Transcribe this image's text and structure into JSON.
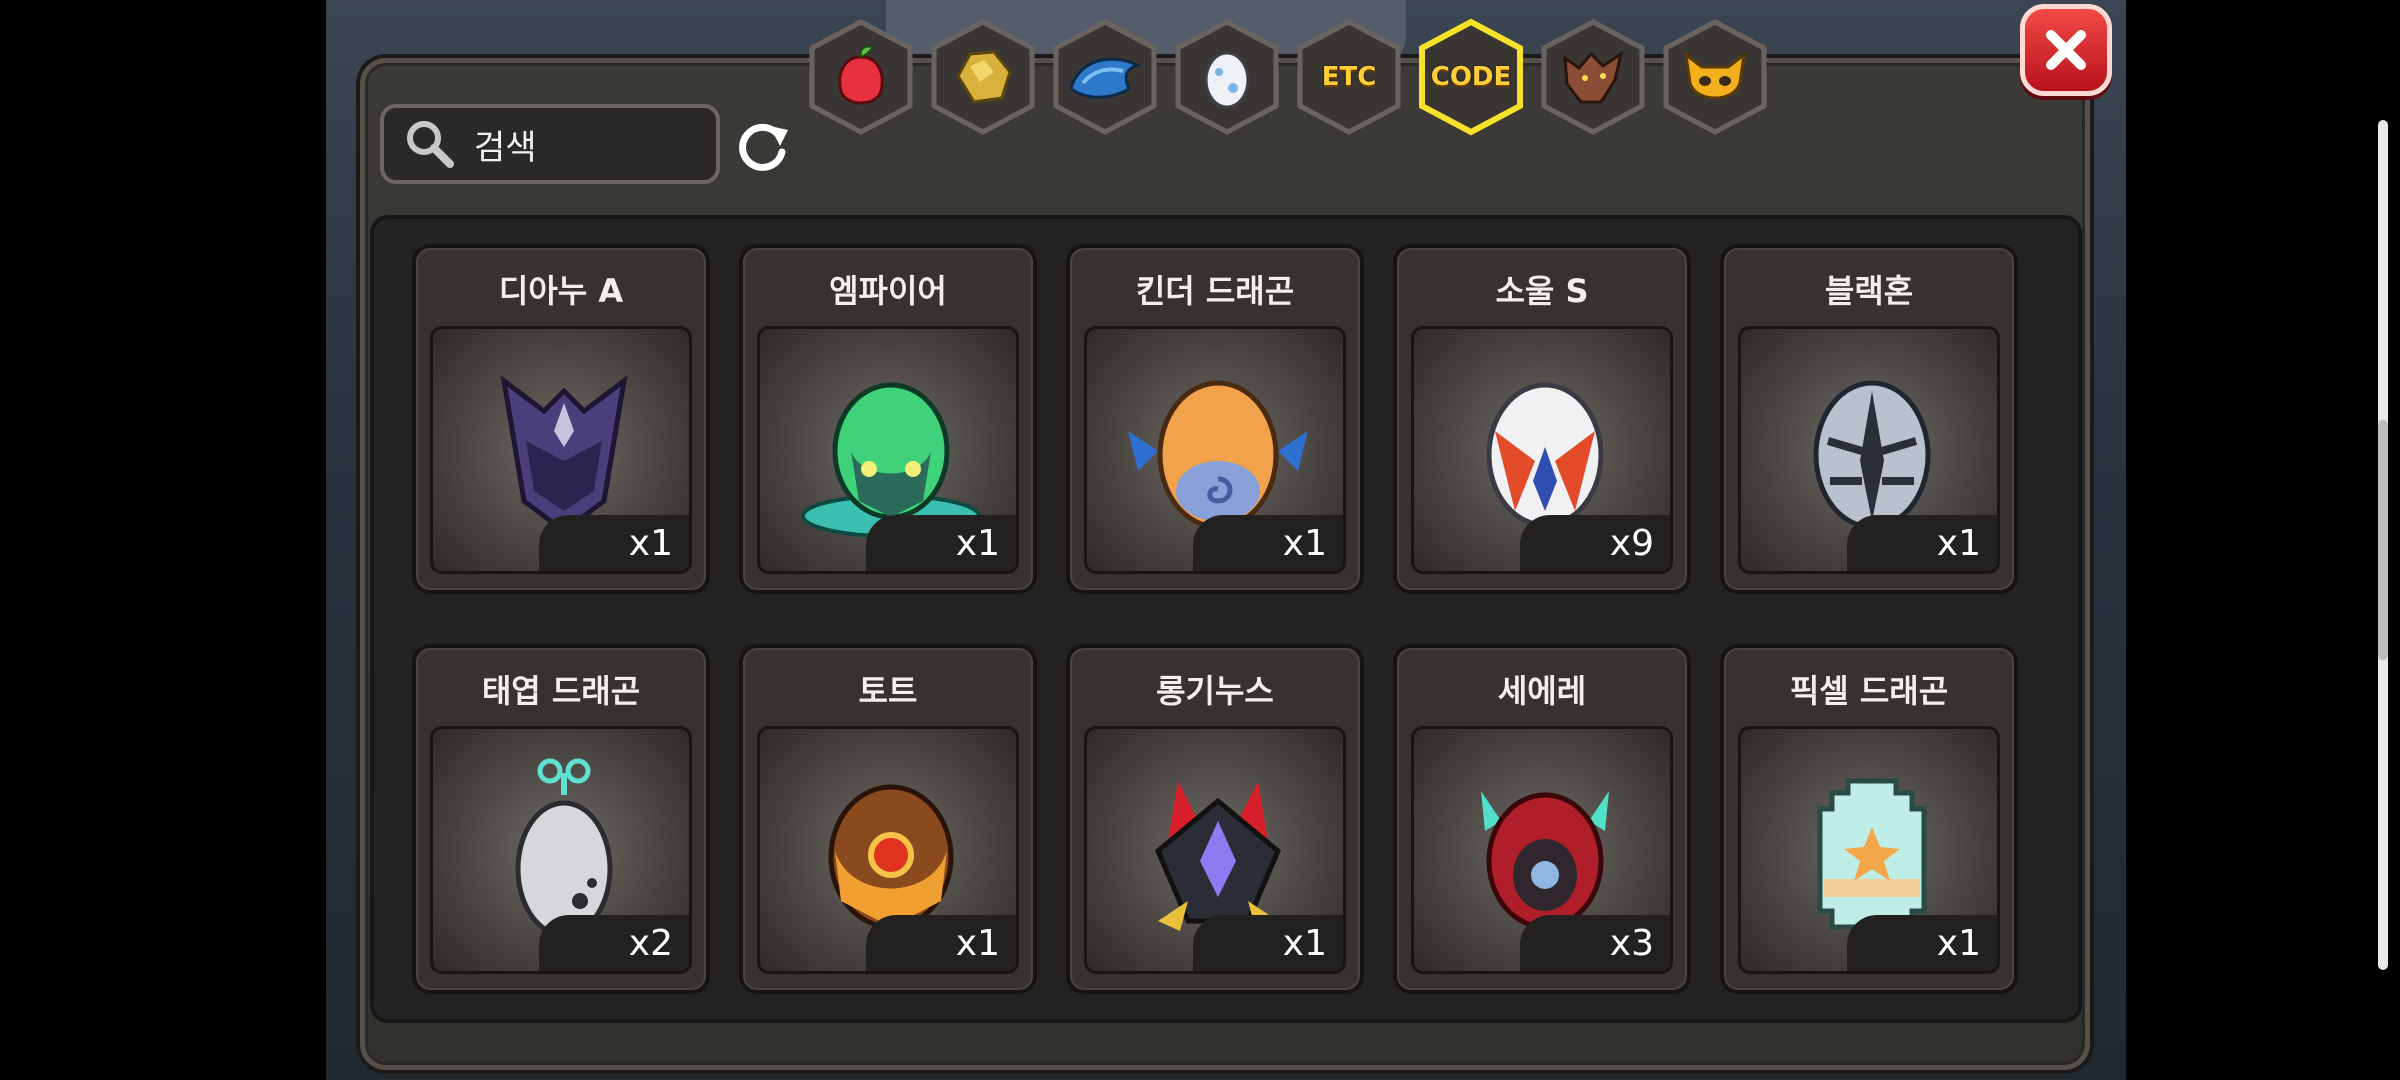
{
  "search": {
    "placeholder": "검색"
  },
  "tabs": [
    {
      "name": "fruit",
      "icon": "fruit-icon"
    },
    {
      "name": "ore",
      "icon": "gold-ore-icon"
    },
    {
      "name": "dragon-scale",
      "icon": "blue-scale-icon"
    },
    {
      "name": "egg",
      "icon": "egg-icon"
    },
    {
      "name": "etc",
      "label": "ETC"
    },
    {
      "name": "code",
      "label": "CODE",
      "selected": true
    },
    {
      "name": "wolf",
      "icon": "wolf-head-icon"
    },
    {
      "name": "goblin",
      "icon": "goblin-face-icon"
    }
  ],
  "items": [
    {
      "name": "디아누 A",
      "qty": "x1"
    },
    {
      "name": "엠파이어",
      "qty": "x1"
    },
    {
      "name": "킨더 드래곤",
      "qty": "x1"
    },
    {
      "name": "소울 S",
      "qty": "x9"
    },
    {
      "name": "블랙혼",
      "qty": "x1"
    },
    {
      "name": "태엽 드래곤",
      "qty": "x2"
    },
    {
      "name": "토트",
      "qty": "x1"
    },
    {
      "name": "롱기누스",
      "qty": "x1"
    },
    {
      "name": "세에레",
      "qty": "x3"
    },
    {
      "name": "픽셀 드래곤",
      "qty": "x1"
    }
  ],
  "colors": {
    "selected_tab_border": "#f7e22a",
    "tab_fill": "#3a3633",
    "close": "#d9252b"
  }
}
